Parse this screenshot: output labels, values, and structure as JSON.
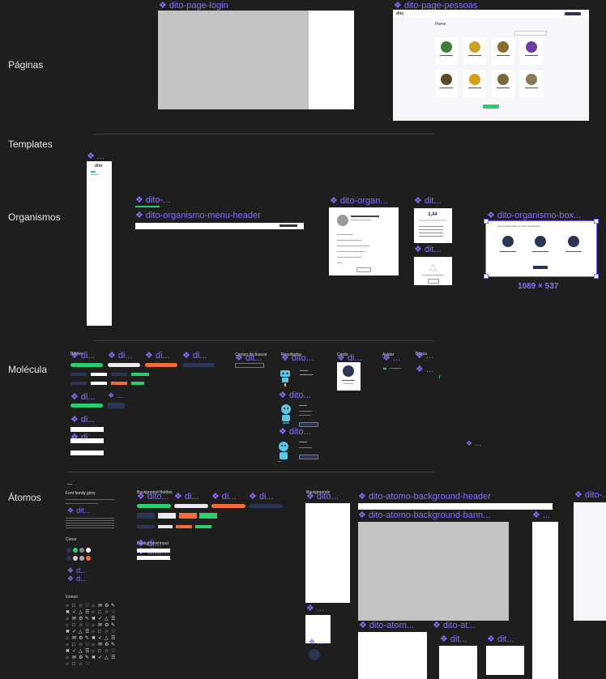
{
  "sections": {
    "paginas": "Páginas",
    "templates": "Templates",
    "organismos": "Organismos",
    "molecula": "Molécula",
    "atomos": "Átomos"
  },
  "pages": {
    "login_label": "dito-page-login",
    "pessoas_label": "dito-page-pessoas",
    "pessoas_logo": "dito",
    "pessoas_title": "Home",
    "pessoas_button": "Ver mais"
  },
  "templates": {
    "frame_label": "..."
  },
  "organisms": {
    "menu_label_a": "dito-...",
    "menu_header_label": "dito-organismo-menu-header",
    "organ_label": "dito-organ...",
    "dit_label_a": "dit...",
    "dit_label_b": "dit...",
    "box_label": "dito-organismo-box...",
    "box_size": "1089 × 537",
    "box_title": "Lorem ipsum dolor sit amet consectetur",
    "score_value": "3,44"
  },
  "molecules": {
    "buttons_header": "Botões",
    "lbl_di": "di...",
    "lbl_dito": "dito...",
    "lbl_dit": "dit...",
    "lbl_dots": "...",
    "lbl_di_a": "di...",
    "lbl_di_b": "di...",
    "lbl_di_c": "di...",
    "resultados_header": "Resultados",
    "cards_header": "Cards",
    "avatar_header": "Avatar",
    "busca_header": "Busca",
    "cor_de_buscar": "Campo de buscar"
  },
  "atoms": {
    "font_family": "Font family glory",
    "cores": "Cores",
    "icones": "Ícones",
    "bg_botoes": "Background Botões",
    "bg_input": "Background input",
    "backgrounds": "Backgrounds",
    "lbl_dito": "dito...",
    "bg_header_label": "dito-atomo-background-header",
    "bg_banner_label": "dito-atomo-background-bann...",
    "lbl_dots": "...",
    "lbl_dito_r": "dito-...",
    "atom_label_a": "dito-atom...",
    "atom_label_b": "dito-at...",
    "lbl_dit_a": "dit...",
    "lbl_dit_b": "dit...",
    "lbl_di": "di...",
    "lbl_di_a": "di...",
    "lbl_di_b": "di...",
    "lbl_di_c": "di...",
    "lbl_d1": "d...",
    "lbl_d2": "d...",
    "lbl_dito2": "dito..."
  },
  "colors": {
    "canvas": "#1e1e1e",
    "accent": "#8c6cff",
    "green": "#2ecc71",
    "orange": "#f26b3a",
    "navy": "#2b3654"
  }
}
